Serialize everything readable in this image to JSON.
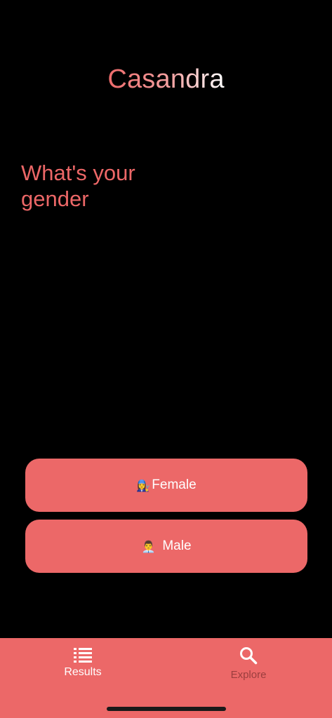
{
  "header": {
    "title": "Casandra"
  },
  "question": {
    "text": "What's your gender"
  },
  "options": [
    {
      "emoji": "👩‍🔧",
      "label": "Female"
    },
    {
      "emoji": "👨‍💼",
      "label": "Male"
    }
  ],
  "bottom_nav": {
    "items": [
      {
        "label": "Results",
        "icon": "list-icon",
        "active": true
      },
      {
        "label": "Explore",
        "icon": "search-icon",
        "active": false
      }
    ]
  },
  "colors": {
    "accent": "#ec6868",
    "background": "#000000",
    "inactive_nav": "#9b3e3e"
  }
}
